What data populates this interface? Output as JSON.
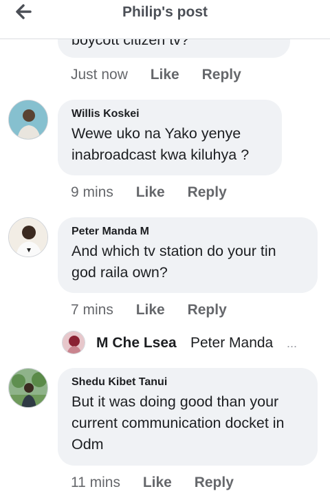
{
  "header": {
    "title": "Philip's post",
    "back_icon": "back-arrow-icon"
  },
  "comments": [
    {
      "text": "boycott citizen tv?",
      "time": "Just now",
      "like": "Like",
      "reply": "Reply"
    },
    {
      "name": "Willis Koskei",
      "text": "Wewe uko na Yako yenye inabroadcast kwa kiluhya ?",
      "time": "9 mins",
      "like": "Like",
      "reply": "Reply"
    },
    {
      "name": "Peter Manda M",
      "text": "And which tv station do your tin god raila own?",
      "time": "7 mins",
      "like": "Like",
      "reply": "Reply"
    },
    {
      "name": "Shedu Kibet Tanui",
      "text": "But it was doing good than your current communication docket in Odm",
      "time": "11 mins",
      "like": "Like",
      "reply": "Reply"
    }
  ],
  "reply_preview": {
    "name": "M Che Lsea",
    "text": "Peter Manda",
    "ellipsis": "..."
  },
  "colors": {
    "bubble": "#f0f2f5",
    "meta": "#65676b",
    "text": "#1c1e21"
  }
}
